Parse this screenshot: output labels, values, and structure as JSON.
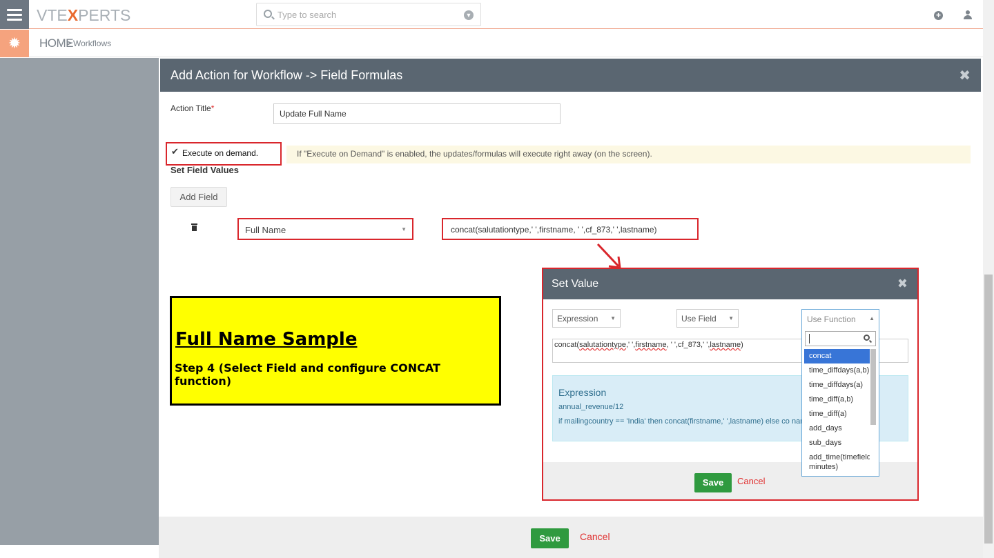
{
  "topbar": {
    "logo_pre": "VTE",
    "logo_x": "X",
    "logo_post": "PERTS",
    "search_placeholder": "Type to search",
    "add_icon": "plus-circle-icon",
    "user_icon": "user-icon"
  },
  "breadcrumb": {
    "home": "HOME",
    "sep": ">",
    "current": "Workflows"
  },
  "modal": {
    "title": "Add Action for Workflow -> Field Formulas",
    "close": "✖",
    "action_title_label": "Action Title",
    "required_mark": "*",
    "action_title_value": "Update Full Name",
    "execute_label": "Execute on demand.",
    "execute_check": "✔",
    "execute_note": "If \"Execute on Demand\" is enabled, the updates/formulas will execute right away (on the screen).",
    "set_field_values": "Set Field Values",
    "add_field": "Add Field",
    "field_name": "Full Name",
    "field_expression": "concat(salutationtype,' ',firstname, ' ',cf_873,' ',lastname)",
    "save": "Save",
    "cancel": "Cancel"
  },
  "sample_box": {
    "title": "Full Name Sample",
    "subtitle": "Step 4 (Select Field and configure CONCAT function)"
  },
  "set_value": {
    "title": "Set Value",
    "close": "✖",
    "type_select": "Expression",
    "field_select": "Use Field",
    "function_select": "Use Function",
    "expr_parts": [
      "concat(",
      "salutationtype",
      ",' ',",
      "firstname",
      ", ' ',cf_873,' ',",
      "lastname",
      ")"
    ],
    "info_heading": "Expression",
    "info_line1": "annual_revenue/12",
    "info_line2": "if mailingcountry == 'India' then concat(firstname,' ',lastname) else co                         name) end",
    "save": "Save",
    "cancel": "Cancel"
  },
  "function_dropdown": {
    "items": [
      "concat",
      "time_diffdays(a,b)",
      "time_diffdays(a)",
      "time_diff(a,b)",
      "time_diff(a)",
      "add_days",
      "sub_days",
      "add_time(timefield, minutes)"
    ],
    "selected": "concat"
  }
}
